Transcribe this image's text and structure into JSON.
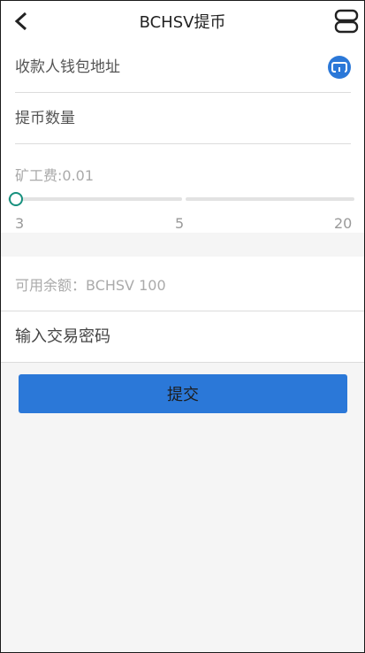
{
  "header": {
    "title": "BCHSV提币",
    "back_icon": "chevron-left-icon",
    "menu_icon": "menu-icon"
  },
  "form": {
    "address_placeholder": "收款人钱包地址",
    "scan_icon": "scan-icon",
    "amount_placeholder": "提币数量",
    "fee_label": "矿工费:0.01",
    "fee_slider": {
      "min": 3,
      "mid": 5,
      "max": 20,
      "value": 3,
      "min_label": "3",
      "mid_label": "5",
      "max_label": "20"
    },
    "balance_text": "可用余额：BCHSV 100",
    "password_placeholder": "输入交易密码",
    "submit_label": "提交"
  },
  "colors": {
    "accent": "#2b78d8",
    "slider_thumb": "#17907e",
    "background": "#f5f5f5"
  }
}
